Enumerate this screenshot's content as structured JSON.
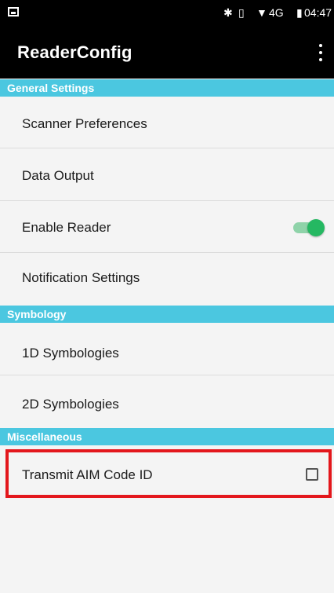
{
  "status_bar": {
    "time": "04:47",
    "network": "4G",
    "icons": [
      "image-notification-icon",
      "bluetooth-icon",
      "vibrate-icon",
      "wifi-icon",
      "battery-icon"
    ]
  },
  "app_bar": {
    "title": "ReaderConfig",
    "menu_icon": "overflow-menu-icon"
  },
  "sections": [
    {
      "title": "General Settings"
    },
    {
      "title": "Symbology"
    },
    {
      "title": "Miscellaneous"
    }
  ],
  "items": {
    "scanner_preferences": "Scanner Preferences",
    "data_output": "Data Output",
    "enable_reader": {
      "label": "Enable Reader",
      "enabled": true
    },
    "notification_settings": "Notification Settings",
    "symbologies_1d": "1D Symbologies",
    "symbologies_2d": "2D Symbologies",
    "transmit_aim": {
      "label": "Transmit AIM Code ID",
      "checked": false
    }
  },
  "colors": {
    "section_header": "#4bc7e0",
    "toggle_on": "#25b862",
    "highlight": "#e3171c"
  }
}
